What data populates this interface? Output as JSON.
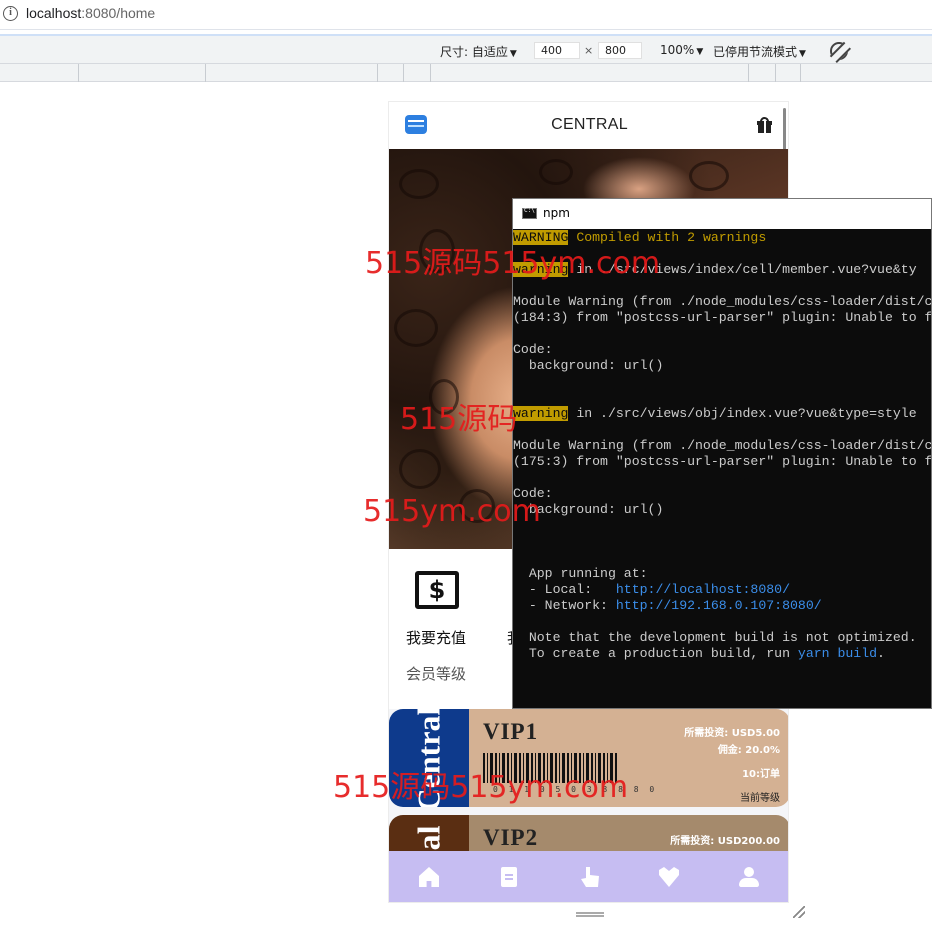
{
  "browser": {
    "url_host": "localhost",
    "url_rest": ":8080/home"
  },
  "devtools": {
    "size_label": "尺寸: 自适应",
    "width": "400",
    "times": "×",
    "height": "800",
    "zoom": "100%",
    "throttle": "已停用节流模式"
  },
  "app": {
    "brand": "CENTRAL",
    "quick": [
      {
        "label": "我要充值"
      },
      {
        "label": "我"
      }
    ],
    "section_title": "会员等级",
    "vip_cards": [
      {
        "side_text": "Central",
        "name": "VIP1",
        "invest": "所需投资:  USD5.00",
        "commission": "佣金:  20.0%",
        "orders": "10:订单",
        "current": "当前等级",
        "barcode_number": "0  1 1 0 5  0 3 8 8 8 0",
        "side_color": "#0e3a8c",
        "body_color": "#d4b193"
      },
      {
        "side_text": "ral",
        "name": "VIP2",
        "invest": "所需投资:  USD200.00",
        "side_color": "#5a2e12",
        "body_color": "#a58a6c"
      }
    ],
    "tabbar_color": "#c6bdf2"
  },
  "terminal": {
    "title": "npm",
    "lines": [
      {
        "tag": "WARNING",
        "text": " Compiled with 2 warnings",
        "text_class": "yel"
      },
      {
        "text": ""
      },
      {
        "tag": "warning",
        "text": " in ./src/views/index/cell/member.vue?vue&ty"
      },
      {
        "text": ""
      },
      {
        "text": "Module Warning (from ./node_modules/css-loader/dist/c"
      },
      {
        "text": "(184:3) from \"postcss-url-parser\" plugin: Unable to f"
      },
      {
        "text": ""
      },
      {
        "text": "Code:"
      },
      {
        "text": "  background: url()"
      },
      {
        "text": ""
      },
      {
        "text": ""
      },
      {
        "tag": "warning",
        "text": " in ./src/views/obj/index.vue?vue&type=style"
      },
      {
        "text": ""
      },
      {
        "text": "Module Warning (from ./node_modules/css-loader/dist/c"
      },
      {
        "text": "(175:3) from \"postcss-url-parser\" plugin: Unable to f"
      },
      {
        "text": ""
      },
      {
        "text": "Code:"
      },
      {
        "text": "  background: url()"
      },
      {
        "text": ""
      },
      {
        "text": ""
      },
      {
        "text": ""
      },
      {
        "text": "  App running at:"
      },
      {
        "text": "  - Local:   ",
        "link": "http://localhost:8080/"
      },
      {
        "text": "  - Network: ",
        "link": "http://192.168.0.107:8080/"
      },
      {
        "text": ""
      },
      {
        "text": "  Note that the development build is not optimized."
      },
      {
        "text": "  To create a production build, run ",
        "link": "yarn build",
        "after": "."
      }
    ]
  },
  "watermarks": [
    "515源码515ym.com",
    "515源码",
    "515ym.com",
    "515源码515ym.com"
  ],
  "colors": {
    "watermark": "#e51b1b",
    "terminal_bg": "#0c0c0c",
    "terminal_warning": "#c19c00",
    "terminal_link": "#3b8eea"
  }
}
